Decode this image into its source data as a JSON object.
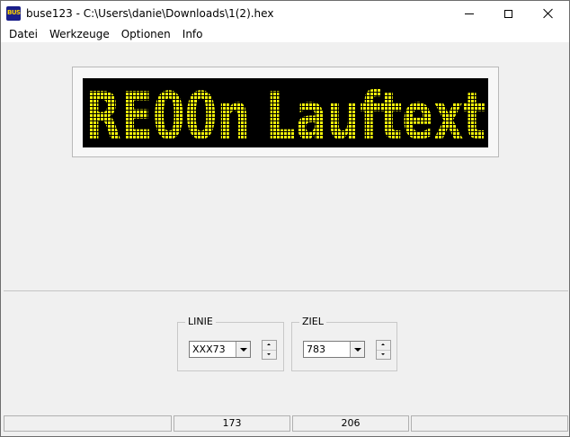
{
  "window": {
    "title": "buse123 - C:\\Users\\danie\\Downloads\\1(2).hex",
    "app_icon_text": "BUS"
  },
  "menu": [
    "Datei",
    "Werkzeuge",
    "Optionen",
    "Info"
  ],
  "display": {
    "text": "RE00n Lauftext",
    "led_color": "#f2f20a",
    "background_color": "#000000"
  },
  "linie": {
    "label": "LINIE",
    "value": "XXX73"
  },
  "ziel": {
    "label": "ZIEL",
    "value": "783"
  },
  "status": [
    "",
    "173",
    "206",
    ""
  ]
}
